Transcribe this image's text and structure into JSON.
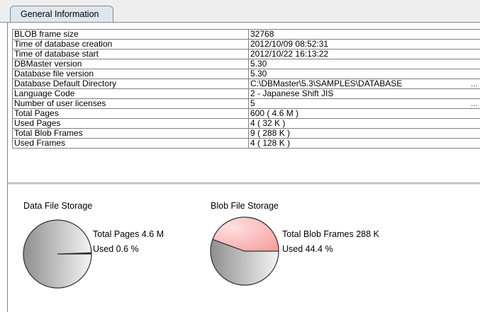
{
  "tab": {
    "label": "General Information"
  },
  "info_rows": [
    {
      "name": "BLOB frame size",
      "value": "32768"
    },
    {
      "name": "Time of database creation",
      "value": "2012/10/09 08:52:31"
    },
    {
      "name": "Time of database start",
      "value": "2012/10/22 16:13:22"
    },
    {
      "name": "DBMaster version",
      "value": "5.30"
    },
    {
      "name": "Database file version",
      "value": "5.30"
    },
    {
      "name": "Database Default Directory",
      "value": "C:\\DBMaster\\5.3\\SAMPLES\\DATABASE",
      "ellipsis": "..."
    },
    {
      "name": "Language Code",
      "value": "2 - Japanese Shift JIS"
    },
    {
      "name": "Number of user licenses",
      "value": "5",
      "ellipsis": "..."
    },
    {
      "name": "Total Pages",
      "value": "600 ( 4.6 M )"
    },
    {
      "name": "Used Pages",
      "value": "4 ( 32 K )"
    },
    {
      "name": "Total Blob Frames",
      "value": "9 ( 288 K )"
    },
    {
      "name": "Used Frames",
      "value": "4 ( 128 K )"
    }
  ],
  "charts": {
    "data_file": {
      "title": "Data File Storage",
      "total_label": "Total Pages 4.6 M",
      "used_label": "Used 0.6 %",
      "used_fraction": 0.006
    },
    "blob_file": {
      "title": "Blob File Storage",
      "total_label": "Total Blob Frames 288 K",
      "used_label": "Used 44.4 %",
      "used_fraction": 0.444
    }
  },
  "colors": {
    "grid_border": "#808080",
    "tab_bg": "#dfe7ee",
    "pie_gray": "#9a9a9a",
    "pie_pink": "#f6a8a8"
  }
}
